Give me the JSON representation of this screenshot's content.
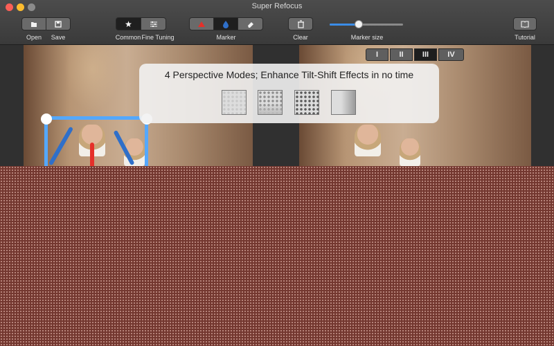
{
  "window": {
    "title": "Super Refocus"
  },
  "toolbar": {
    "open_label": "Open",
    "save_label": "Save",
    "common_label": "Common",
    "fine_tuning_label": "Fine Tuning",
    "marker_label": "Marker",
    "clear_label": "Clear",
    "marker_size_label": "Marker size",
    "tutorial_label": "Tutorial",
    "marker_size_value": 0.4
  },
  "overlay": {
    "headline": "4 Perspective Modes; Enhance Tilt-Shift Effects in no time"
  },
  "modes": [
    "I",
    "II",
    "III",
    "IV"
  ],
  "selected_mode": "III",
  "colors": {
    "mask": "#73372f",
    "selection": "#54a8ff",
    "marker_red": "#e5302a",
    "marker_blue": "#2f6fc9",
    "slider_fill": "#3b8de8"
  }
}
